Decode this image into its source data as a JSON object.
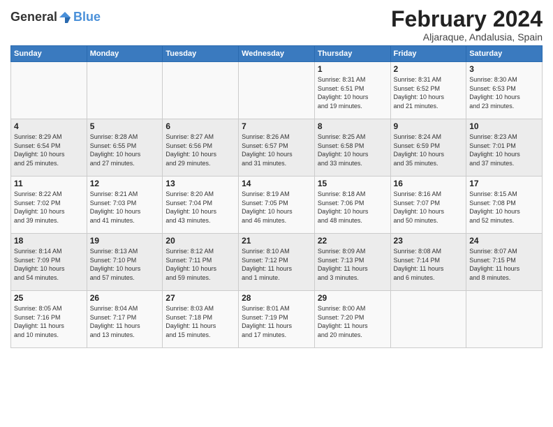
{
  "header": {
    "logo_general": "General",
    "logo_blue": "Blue",
    "title": "February 2024",
    "subtitle": "Aljaraque, Andalusia, Spain"
  },
  "weekdays": [
    "Sunday",
    "Monday",
    "Tuesday",
    "Wednesday",
    "Thursday",
    "Friday",
    "Saturday"
  ],
  "weeks": [
    [
      {
        "day": "",
        "info": ""
      },
      {
        "day": "",
        "info": ""
      },
      {
        "day": "",
        "info": ""
      },
      {
        "day": "",
        "info": ""
      },
      {
        "day": "1",
        "info": "Sunrise: 8:31 AM\nSunset: 6:51 PM\nDaylight: 10 hours\nand 19 minutes."
      },
      {
        "day": "2",
        "info": "Sunrise: 8:31 AM\nSunset: 6:52 PM\nDaylight: 10 hours\nand 21 minutes."
      },
      {
        "day": "3",
        "info": "Sunrise: 8:30 AM\nSunset: 6:53 PM\nDaylight: 10 hours\nand 23 minutes."
      }
    ],
    [
      {
        "day": "4",
        "info": "Sunrise: 8:29 AM\nSunset: 6:54 PM\nDaylight: 10 hours\nand 25 minutes."
      },
      {
        "day": "5",
        "info": "Sunrise: 8:28 AM\nSunset: 6:55 PM\nDaylight: 10 hours\nand 27 minutes."
      },
      {
        "day": "6",
        "info": "Sunrise: 8:27 AM\nSunset: 6:56 PM\nDaylight: 10 hours\nand 29 minutes."
      },
      {
        "day": "7",
        "info": "Sunrise: 8:26 AM\nSunset: 6:57 PM\nDaylight: 10 hours\nand 31 minutes."
      },
      {
        "day": "8",
        "info": "Sunrise: 8:25 AM\nSunset: 6:58 PM\nDaylight: 10 hours\nand 33 minutes."
      },
      {
        "day": "9",
        "info": "Sunrise: 8:24 AM\nSunset: 6:59 PM\nDaylight: 10 hours\nand 35 minutes."
      },
      {
        "day": "10",
        "info": "Sunrise: 8:23 AM\nSunset: 7:01 PM\nDaylight: 10 hours\nand 37 minutes."
      }
    ],
    [
      {
        "day": "11",
        "info": "Sunrise: 8:22 AM\nSunset: 7:02 PM\nDaylight: 10 hours\nand 39 minutes."
      },
      {
        "day": "12",
        "info": "Sunrise: 8:21 AM\nSunset: 7:03 PM\nDaylight: 10 hours\nand 41 minutes."
      },
      {
        "day": "13",
        "info": "Sunrise: 8:20 AM\nSunset: 7:04 PM\nDaylight: 10 hours\nand 43 minutes."
      },
      {
        "day": "14",
        "info": "Sunrise: 8:19 AM\nSunset: 7:05 PM\nDaylight: 10 hours\nand 46 minutes."
      },
      {
        "day": "15",
        "info": "Sunrise: 8:18 AM\nSunset: 7:06 PM\nDaylight: 10 hours\nand 48 minutes."
      },
      {
        "day": "16",
        "info": "Sunrise: 8:16 AM\nSunset: 7:07 PM\nDaylight: 10 hours\nand 50 minutes."
      },
      {
        "day": "17",
        "info": "Sunrise: 8:15 AM\nSunset: 7:08 PM\nDaylight: 10 hours\nand 52 minutes."
      }
    ],
    [
      {
        "day": "18",
        "info": "Sunrise: 8:14 AM\nSunset: 7:09 PM\nDaylight: 10 hours\nand 54 minutes."
      },
      {
        "day": "19",
        "info": "Sunrise: 8:13 AM\nSunset: 7:10 PM\nDaylight: 10 hours\nand 57 minutes."
      },
      {
        "day": "20",
        "info": "Sunrise: 8:12 AM\nSunset: 7:11 PM\nDaylight: 10 hours\nand 59 minutes."
      },
      {
        "day": "21",
        "info": "Sunrise: 8:10 AM\nSunset: 7:12 PM\nDaylight: 11 hours\nand 1 minute."
      },
      {
        "day": "22",
        "info": "Sunrise: 8:09 AM\nSunset: 7:13 PM\nDaylight: 11 hours\nand 3 minutes."
      },
      {
        "day": "23",
        "info": "Sunrise: 8:08 AM\nSunset: 7:14 PM\nDaylight: 11 hours\nand 6 minutes."
      },
      {
        "day": "24",
        "info": "Sunrise: 8:07 AM\nSunset: 7:15 PM\nDaylight: 11 hours\nand 8 minutes."
      }
    ],
    [
      {
        "day": "25",
        "info": "Sunrise: 8:05 AM\nSunset: 7:16 PM\nDaylight: 11 hours\nand 10 minutes."
      },
      {
        "day": "26",
        "info": "Sunrise: 8:04 AM\nSunset: 7:17 PM\nDaylight: 11 hours\nand 13 minutes."
      },
      {
        "day": "27",
        "info": "Sunrise: 8:03 AM\nSunset: 7:18 PM\nDaylight: 11 hours\nand 15 minutes."
      },
      {
        "day": "28",
        "info": "Sunrise: 8:01 AM\nSunset: 7:19 PM\nDaylight: 11 hours\nand 17 minutes."
      },
      {
        "day": "29",
        "info": "Sunrise: 8:00 AM\nSunset: 7:20 PM\nDaylight: 11 hours\nand 20 minutes."
      },
      {
        "day": "",
        "info": ""
      },
      {
        "day": "",
        "info": ""
      }
    ]
  ]
}
